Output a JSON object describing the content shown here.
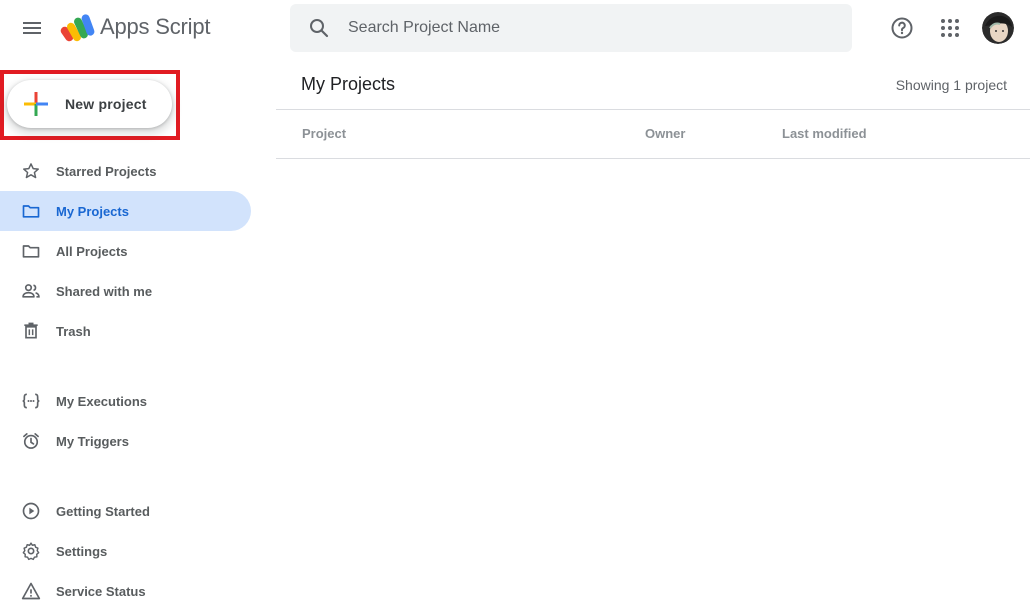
{
  "header": {
    "app_title": "Apps Script",
    "search": {
      "placeholder": "Search Project Name",
      "value": ""
    },
    "icons": {
      "menu": "hamburger-menu-icon",
      "search": "search-icon",
      "help": "help-icon",
      "apps": "apps-grid-icon"
    }
  },
  "sidebar": {
    "new_project_label": "New project",
    "highlight_color": "#e11b22",
    "groups": [
      [
        {
          "label": "Starred Projects",
          "icon": "star-icon"
        },
        {
          "label": "My Projects",
          "icon": "folder-icon",
          "active": true
        },
        {
          "label": "All Projects",
          "icon": "folder-icon"
        },
        {
          "label": "Shared with me",
          "icon": "people-icon"
        },
        {
          "label": "Trash",
          "icon": "trash-icon"
        }
      ],
      [
        {
          "label": "My Executions",
          "icon": "executions-icon"
        },
        {
          "label": "My Triggers",
          "icon": "alarm-icon"
        }
      ],
      [
        {
          "label": "Getting Started",
          "icon": "play-circle-icon"
        },
        {
          "label": "Settings",
          "icon": "gear-icon"
        },
        {
          "label": "Service Status",
          "icon": "warning-icon"
        }
      ]
    ]
  },
  "main": {
    "title": "My Projects",
    "count_text": "Showing 1 project",
    "columns": [
      "Project",
      "Owner",
      "Last modified"
    ]
  },
  "colors": {
    "active_nav_bg": "#d2e3fc",
    "active_nav_text": "#1967d2",
    "search_bg": "#f1f3f4"
  }
}
